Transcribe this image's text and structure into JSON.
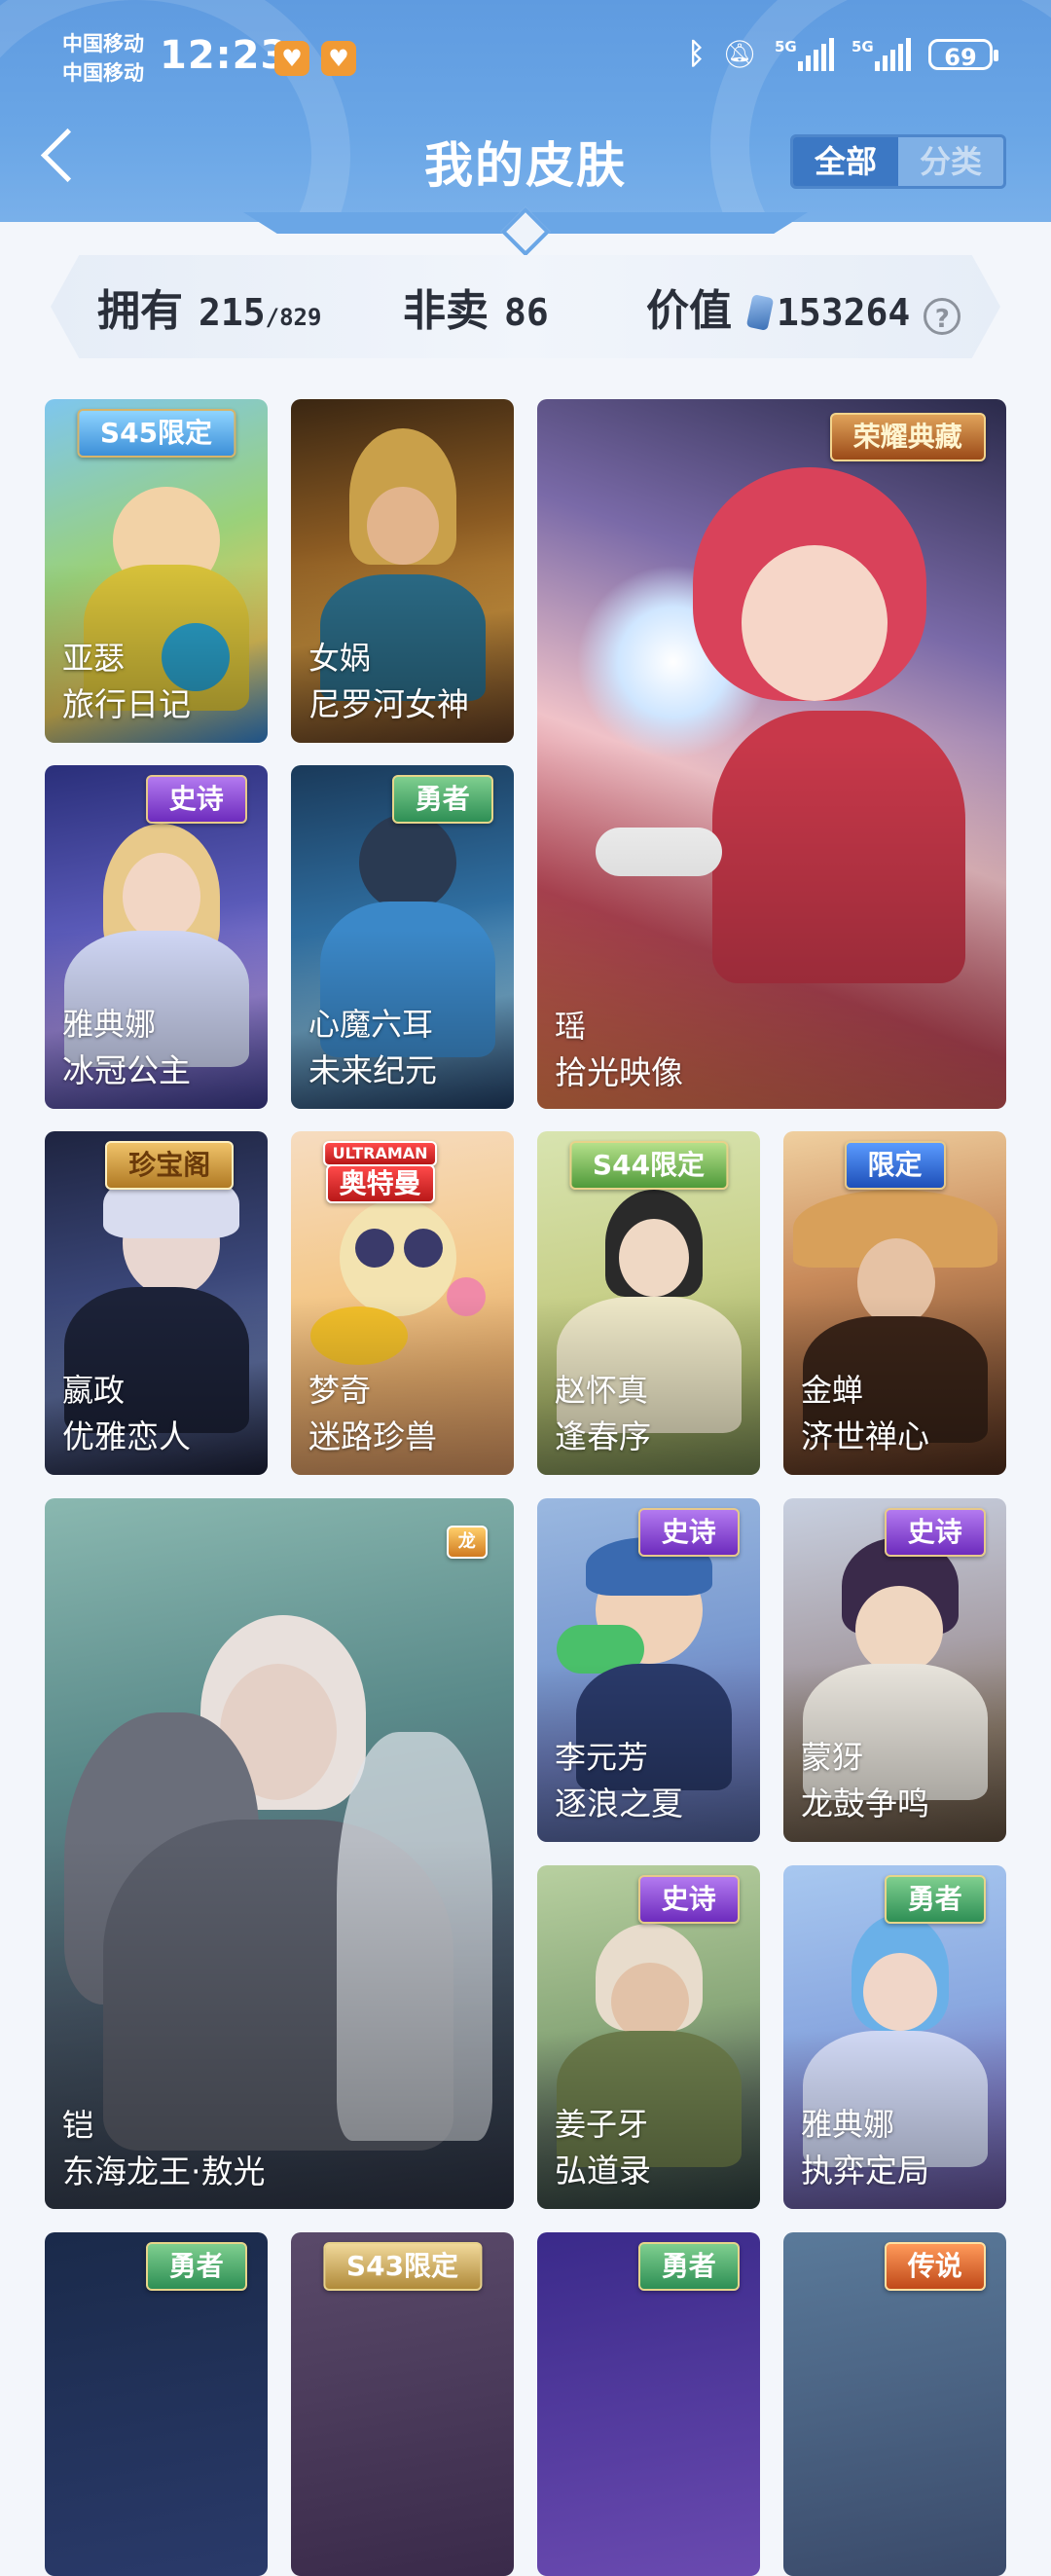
{
  "status_bar": {
    "carrier_1": "中国移动",
    "carrier_2": "中国移动",
    "time": "12:23",
    "network_1": "5G",
    "network_2": "5G",
    "battery": "69"
  },
  "header": {
    "title": "我的皮肤",
    "segment_all": "全部",
    "segment_category": "分类"
  },
  "stats": {
    "owned_label": "拥有",
    "owned_value": "215",
    "owned_total": "/829",
    "not_for_sale_label": "非卖",
    "not_for_sale_value": "86",
    "value_label": "价值",
    "value_amount": "153264",
    "help_glyph": "?"
  },
  "skins": [
    {
      "hero": "亚瑟",
      "skin": "旅行日记",
      "badge": "S45限定"
    },
    {
      "hero": "女娲",
      "skin": "尼罗河女神",
      "badge": ""
    },
    {
      "hero": "瑶",
      "skin": "拾光映像",
      "badge": "荣耀典藏"
    },
    {
      "hero": "雅典娜",
      "skin": "冰冠公主",
      "badge": "史诗"
    },
    {
      "hero": "心魔六耳",
      "skin": "未来纪元",
      "badge": "勇者"
    },
    {
      "hero": "嬴政",
      "skin": "优雅恋人",
      "badge": "珍宝阁"
    },
    {
      "hero": "梦奇",
      "skin": "迷路珍兽",
      "badge": "奥特曼",
      "badge_top": "ULTRAMAN"
    },
    {
      "hero": "赵怀真",
      "skin": "逢春序",
      "badge": "S44限定"
    },
    {
      "hero": "金蝉",
      "skin": "济世禅心",
      "badge": "限定"
    },
    {
      "hero": "铠",
      "skin": "东海龙王·敖光",
      "badge": ""
    },
    {
      "hero": "李元芳",
      "skin": "逐浪之夏",
      "badge": "史诗"
    },
    {
      "hero": "蒙犽",
      "skin": "龙鼓争鸣",
      "badge": "史诗"
    },
    {
      "hero": "姜子牙",
      "skin": "弘道录",
      "badge": "史诗"
    },
    {
      "hero": "雅典娜",
      "skin": "执弈定局",
      "badge": "勇者"
    },
    {
      "hero": "",
      "skin": "",
      "badge": "勇者"
    },
    {
      "hero": "",
      "skin": "",
      "badge": "S43限定"
    },
    {
      "hero": "",
      "skin": "",
      "badge": "勇者"
    },
    {
      "hero": "",
      "skin": "",
      "badge": "传说"
    }
  ],
  "colors": {
    "header_blue": "#6aa6e6",
    "segment_active": "#3c78c4",
    "page_bg": "#f3f6fb"
  }
}
